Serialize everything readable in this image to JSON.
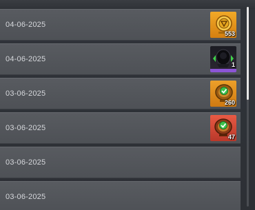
{
  "history": {
    "rows": [
      {
        "date": "04-06-2025",
        "reward": {
          "icon": "gold-crate-icon",
          "count": "553",
          "rarity_color": "#e9a024"
        }
      },
      {
        "date": "04-06-2025",
        "reward": {
          "icon": "dark-crate-icon",
          "count": "1",
          "rarity_color": "#8c55d6"
        }
      },
      {
        "date": "03-06-2025",
        "reward": {
          "icon": "checked-crate-icon",
          "count": "260",
          "rarity_color": "#e29a25"
        }
      },
      {
        "date": "03-06-2025",
        "reward": {
          "icon": "checked-crate-icon",
          "count": "47",
          "rarity_color": "#d94a37"
        }
      },
      {
        "date": "03-06-2025",
        "reward": null
      },
      {
        "date": "03-06-2025",
        "reward": null
      }
    ]
  }
}
